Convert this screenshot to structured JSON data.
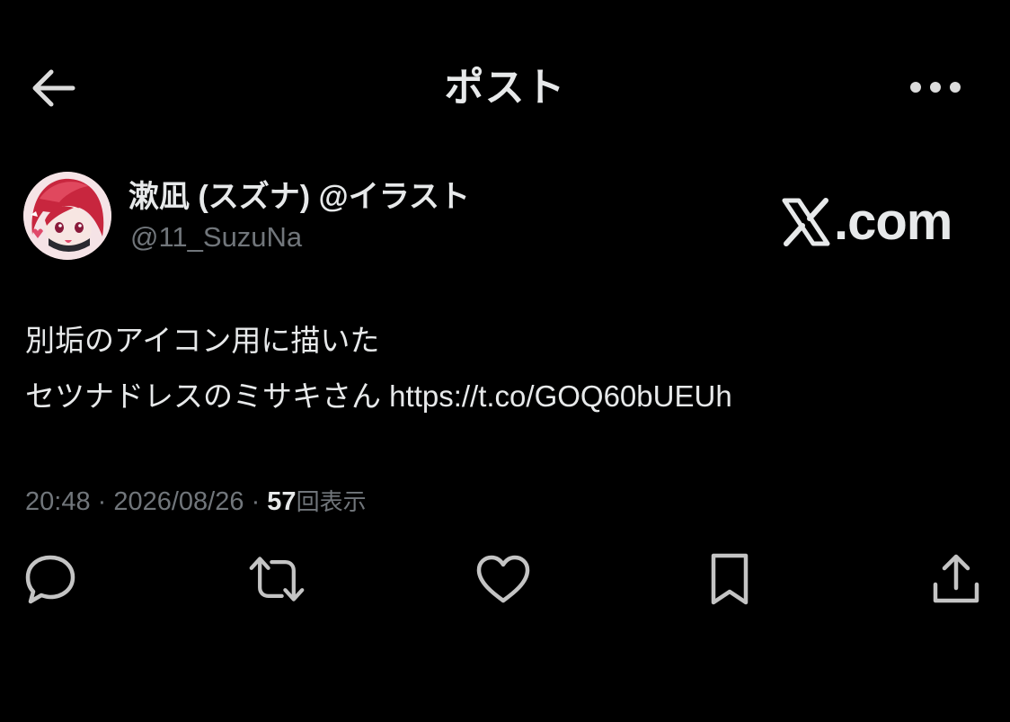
{
  "header": {
    "title": "ポスト",
    "back_icon": "arrow-left-icon",
    "more_icon": "more-horizontal-icon"
  },
  "author": {
    "display_name": "漱凪 (スズナ) @イラスト",
    "handle": "@11_SuzuNa"
  },
  "brand": {
    "text": ".com",
    "icon": "x-logo-icon"
  },
  "tweet": {
    "line1": "別垢のアイコン用に描いた",
    "line2_text": "セツナドレスのミサキさん ",
    "link": "https://t.co/GOQ60bUEUh"
  },
  "meta": {
    "time": "20:48",
    "sep1": " · ",
    "date": "2026/08/26",
    "sep2": " · ",
    "views_count": "57",
    "views_label": "回表示"
  },
  "actions": [
    {
      "name": "reply",
      "icon": "comment-icon"
    },
    {
      "name": "repost",
      "icon": "repost-icon"
    },
    {
      "name": "like",
      "icon": "heart-icon"
    },
    {
      "name": "bookmark",
      "icon": "bookmark-icon"
    },
    {
      "name": "share",
      "icon": "share-icon"
    }
  ],
  "colors": {
    "background": "#000000",
    "text_primary": "#e7e9ea",
    "text_secondary": "#71767b",
    "icon": "#c4c4c4"
  }
}
